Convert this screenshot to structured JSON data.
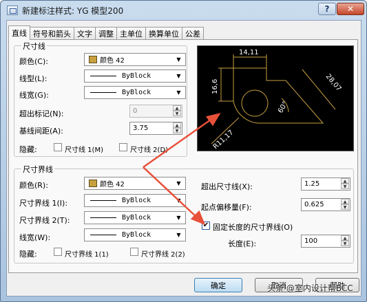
{
  "window": {
    "title": "新建标注样式: YG 模型200",
    "help_label": "?",
    "close_label": "✕"
  },
  "tabs": [
    "直线",
    "符号和箭头",
    "文字",
    "调整",
    "主单位",
    "换算单位",
    "公差"
  ],
  "dim_line_group": {
    "title": "尺寸线",
    "color_label": "颜色(C):",
    "color_value": "颜色 42",
    "linetype_label": "线型(L):",
    "linetype_value": "ByBlock",
    "lineweight_label": "线宽(G):",
    "lineweight_value": "ByBlock",
    "extend_label": "超出标记(N):",
    "extend_value": "0",
    "baseline_label": "基线间距(A):",
    "baseline_value": "3.75",
    "suppress_label": "隐藏:",
    "suppress_1": "尺寸线 1(M)",
    "suppress_2": "尺寸线 2(D)"
  },
  "ext_line_group": {
    "title": "尺寸界线",
    "color_label": "颜色(R):",
    "color_value": "颜色 42",
    "linetype1_label": "尺寸界线 1(I):",
    "linetype1_value": "ByBlock",
    "linetype2_label": "尺寸界线 2(T):",
    "linetype2_value": "ByBlock",
    "lineweight_label": "线宽(W):",
    "lineweight_value": "ByBlock",
    "suppress_label": "隐藏:",
    "suppress_1": "尺寸界线 1(1)",
    "suppress_2": "尺寸界线 2(2)",
    "extend_label": "超出尺寸线(X):",
    "extend_value": "1.25",
    "offset_label": "起点偏移量(F):",
    "offset_value": "0.625",
    "fixed_label": "固定长度的尺寸界线(O)",
    "fixed_checked": true,
    "length_label": "长度(E):",
    "length_value": "100"
  },
  "preview": {
    "dim_top": "14,11",
    "dim_left": "16,6",
    "dim_right": "28,07",
    "dim_angle": "60°",
    "dim_radius": "R11,17"
  },
  "buttons": {
    "ok": "确定",
    "cancel": "取消",
    "help": "帮助"
  },
  "watermark": "头条 @室内设计帮BCC",
  "colors": {
    "dim_color": "#c8a040",
    "annotation_arrow": "#e8503a"
  }
}
